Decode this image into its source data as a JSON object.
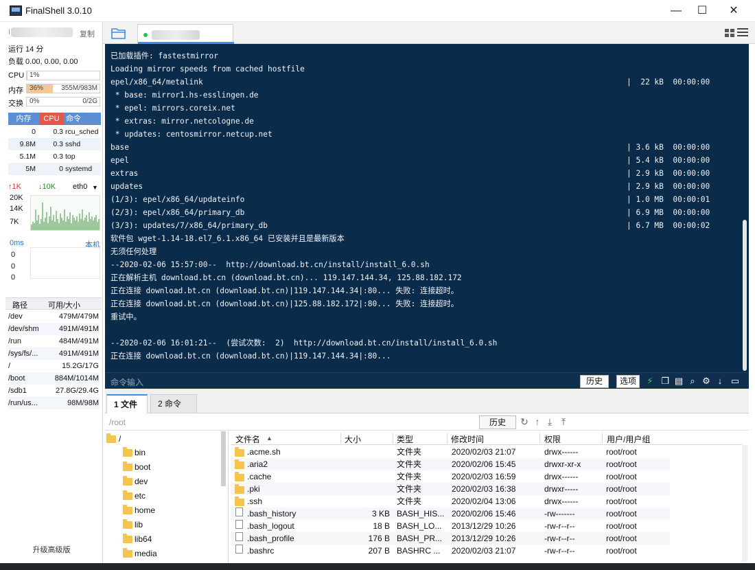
{
  "window": {
    "title": "FinalShell 3.0.10",
    "minimize_glyph": "—",
    "maximize_glyph": "☐",
    "close_glyph": "✕"
  },
  "sidebar": {
    "ip_prefix": "II",
    "copy_label": "复制",
    "uptime": "运行 14 分",
    "load": "负载 0.00, 0.00, 0.00",
    "cpu_label": "CPU",
    "cpu_pct": "1%",
    "cpu_fraction": 0.01,
    "mem_label": "内存",
    "mem_pct": "36%",
    "mem_fraction": 0.36,
    "mem_value": "355M/983M",
    "swap_label": "交换",
    "swap_pct": "0%",
    "swap_value": "0/2G",
    "proc_headers": [
      "内存",
      "CPU",
      "命令"
    ],
    "processes": [
      {
        "mem": "0",
        "cpu": "0.3",
        "cmd": "rcu_sched"
      },
      {
        "mem": "9.8M",
        "cpu": "0.3",
        "cmd": "sshd"
      },
      {
        "mem": "5.1M",
        "cpu": "0.3",
        "cmd": "top"
      },
      {
        "mem": "5M",
        "cpu": "0",
        "cmd": "systemd"
      }
    ],
    "net_up": "↑1K",
    "net_down": "↓10K",
    "net_iface": "eth0",
    "net_ticks": [
      "20K",
      "14K",
      "7K"
    ],
    "latency_label": "0ms",
    "latency_host": "本机",
    "latency_values": [
      "0",
      "0",
      "0"
    ],
    "disk_headers": [
      "路径",
      "可用/大小"
    ],
    "disks": [
      {
        "path": "/dev",
        "size": "479M/479M"
      },
      {
        "path": "/dev/shm",
        "size": "491M/491M"
      },
      {
        "path": "/run",
        "size": "484M/491M"
      },
      {
        "path": "/sys/fs/...",
        "size": "491M/491M"
      },
      {
        "path": "/",
        "size": "15.2G/17G"
      },
      {
        "path": "/boot",
        "size": "884M/1014M"
      },
      {
        "path": "/sdb1",
        "size": "27.8G/29.4G"
      },
      {
        "path": "/run/us...",
        "size": "98M/98M"
      }
    ],
    "upgrade_label": "升级高级版"
  },
  "terminal": {
    "lines": [
      "已加载插件: fastestmirror",
      "Loading mirror speeds from cached hostfile",
      "epel/x86_64/metalink",
      " * base: mirror1.hs-esslingen.de",
      " * epel: mirrors.coreix.net",
      " * extras: mirror.netcologne.de",
      " * updates: centosmirror.netcup.net",
      "base",
      "epel",
      "extras",
      "updates",
      "(1/3): epel/x86_64/updateinfo",
      "(2/3): epel/x86_64/primary_db",
      "(3/3): updates/7/x86_64/primary_db",
      "软件包 wget-1.14-18.el7_6.1.x86_64 已安装并且是最新版本",
      "无须任何处理",
      "--2020-02-06 15:57:00--  http://download.bt.cn/install/install_6.0.sh",
      "正在解析主机 download.bt.cn (download.bt.cn)... 119.147.144.34, 125.88.182.172",
      "正在连接 download.bt.cn (download.bt.cn)|119.147.144.34|:80... 失败: 连接超时。",
      "正在连接 download.bt.cn (download.bt.cn)|125.88.182.172|:80... 失败: 连接超时。",
      "重试中。",
      "",
      "--2020-02-06 16:01:21--  (尝试次数:  2)  http://download.bt.cn/install/install_6.0.sh",
      "正在连接 download.bt.cn (download.bt.cn)|119.147.144.34|:80..."
    ],
    "right_lines": [
      {
        "row": 2,
        "text": "|  22 kB  00:00:00"
      },
      {
        "row": 7,
        "text": "| 3.6 kB  00:00:00"
      },
      {
        "row": 8,
        "text": "| 5.4 kB  00:00:00"
      },
      {
        "row": 9,
        "text": "| 2.9 kB  00:00:00"
      },
      {
        "row": 10,
        "text": "| 2.9 kB  00:00:00"
      },
      {
        "row": 11,
        "text": "| 1.0 MB  00:00:01"
      },
      {
        "row": 12,
        "text": "| 6.9 MB  00:00:00"
      },
      {
        "row": 13,
        "text": "| 6.7 MB  00:00:02"
      }
    ],
    "cmd_placeholder": "命令输入",
    "history_label": "历史",
    "options_label": "选项"
  },
  "bottom_tabs": [
    "1 文件",
    "2 命令"
  ],
  "filebrowser": {
    "path": "/root",
    "history_label": "历史",
    "tree": [
      "/",
      "bin",
      "boot",
      "dev",
      "etc",
      "home",
      "lib",
      "lib64",
      "media"
    ],
    "columns": [
      "文件名",
      "大小",
      "类型",
      "修改时间",
      "权限",
      "用户/用户组"
    ],
    "files": [
      {
        "name": ".acme.sh",
        "size": "",
        "type": "文件夹",
        "mtime": "2020/02/03 21:07",
        "perm": "drwx------",
        "owner": "root/root",
        "folder": true
      },
      {
        "name": ".aria2",
        "size": "",
        "type": "文件夹",
        "mtime": "2020/02/06 15:45",
        "perm": "drwxr-xr-x",
        "owner": "root/root",
        "folder": true
      },
      {
        "name": ".cache",
        "size": "",
        "type": "文件夹",
        "mtime": "2020/02/03 16:59",
        "perm": "drwx------",
        "owner": "root/root",
        "folder": true
      },
      {
        "name": ".pki",
        "size": "",
        "type": "文件夹",
        "mtime": "2020/02/03 16:38",
        "perm": "drwxr-----",
        "owner": "root/root",
        "folder": true
      },
      {
        "name": ".ssh",
        "size": "",
        "type": "文件夹",
        "mtime": "2020/02/04 13:06",
        "perm": "drwx------",
        "owner": "root/root",
        "folder": true
      },
      {
        "name": ".bash_history",
        "size": "3 KB",
        "type": "BASH_HIS...",
        "mtime": "2020/02/06 15:46",
        "perm": "-rw-------",
        "owner": "root/root",
        "folder": false
      },
      {
        "name": ".bash_logout",
        "size": "18 B",
        "type": "BASH_LO...",
        "mtime": "2013/12/29 10:26",
        "perm": "-rw-r--r--",
        "owner": "root/root",
        "folder": false
      },
      {
        "name": ".bash_profile",
        "size": "176 B",
        "type": "BASH_PR...",
        "mtime": "2013/12/29 10:26",
        "perm": "-rw-r--r--",
        "owner": "root/root",
        "folder": false
      },
      {
        "name": ".bashrc",
        "size": "207 B",
        "type": "BASHRC ...",
        "mtime": "2020/02/03 21:07",
        "perm": "-rw-r--r--",
        "owner": "root/root",
        "folder": false
      }
    ]
  },
  "colors": {
    "terminal_bg": "#0b2b4b",
    "accent": "#3c8ee8",
    "proc_header_mem": "#5b8fd3",
    "proc_header_cpu": "#e05a4c",
    "proc_header_cmd": "#5b8fd3",
    "folder": "#f5c44e"
  }
}
